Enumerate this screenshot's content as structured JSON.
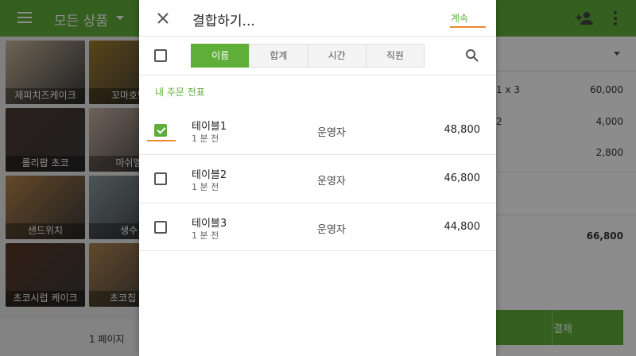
{
  "app": {
    "category_title": "모든 상품",
    "brand_color": "#5fae3a",
    "accent_color": "#f0882c"
  },
  "products": [
    {
      "label": "제피치즈케이크",
      "color": "#c9b79c"
    },
    {
      "label": "꼬마호박",
      "color": "#9f7d2e"
    },
    {
      "label": "롤리팝 초코",
      "color": "#4b3a34"
    },
    {
      "label": "마쉬멜",
      "color": "#c9b4a6"
    },
    {
      "label": "샌드위치",
      "color": "#b7844a"
    },
    {
      "label": "생수",
      "color": "#8a9aa0"
    },
    {
      "label": "초코시럽 케이크",
      "color": "#5a3826"
    },
    {
      "label": "초코칩 머",
      "color": "#b08653"
    }
  ],
  "pager": {
    "text": "1 페이지"
  },
  "order": {
    "line1": {
      "qty": "1 x 3",
      "value": "60,000"
    },
    "line2": {
      "qty": "2",
      "value": "4,000"
    },
    "line3": {
      "value": "2,800"
    },
    "total": "66,800",
    "pay_label": "결제"
  },
  "dialog": {
    "title": "결합하기...",
    "continue_label": "계속",
    "tabs": [
      "이름",
      "합계",
      "시간",
      "직원"
    ],
    "active_tab": 0,
    "section_label": "내 주문 전표",
    "items": [
      {
        "name": "테이블1",
        "time": "1 분 전",
        "employee": "운영자",
        "amount": "48,800",
        "checked": true
      },
      {
        "name": "테이블2",
        "time": "1 분 전",
        "employee": "운영자",
        "amount": "46,800",
        "checked": false
      },
      {
        "name": "테이블3",
        "time": "1 분 전",
        "employee": "운영자",
        "amount": "44,800",
        "checked": false
      }
    ]
  }
}
